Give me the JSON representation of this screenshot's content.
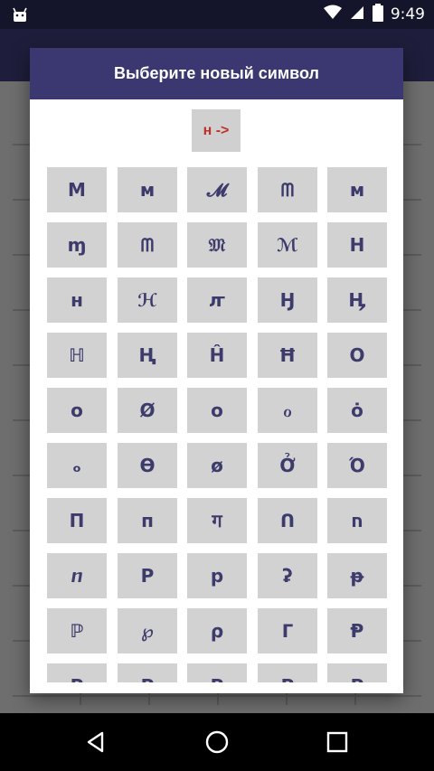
{
  "status_bar": {
    "time": "9:49",
    "icons": [
      "android-icon",
      "wifi-icon",
      "signal-icon",
      "battery-icon"
    ]
  },
  "dialog": {
    "title": "Выберите новый символ",
    "current_symbol": "н ->",
    "symbols": [
      "М",
      "м",
      "𝓜",
      "ᗰ",
      "ᴍ",
      "ɱ",
      "ᗰ",
      "𝔐",
      "ℳ",
      "Н",
      "н",
      "ℋ",
      "ꙥ",
      "Ӈ",
      "Ӊ",
      "ℍ",
      "Ⱨ",
      "Ĥ",
      "Ħ",
      "О",
      "о",
      "Ø",
      "ᴏ",
      "ℴ",
      "ȯ",
      "ₒ",
      "Ѳ",
      "ø",
      "Ở",
      "Ό",
      "П",
      "п",
      "ग",
      "ᑎ",
      "ח",
      "ⴖ",
      "Р",
      "р",
      "ʡ",
      "ᵽ",
      "ℙ",
      "℘",
      "ρ",
      "ᒥ",
      "Ᵽ",
      "Р",
      "Р",
      "Р",
      "Р",
      "Р"
    ]
  },
  "colors": {
    "status_bar_bg": "#14142a",
    "dialog_header_bg": "#3b3770",
    "symbol_text": "#3d3b6b",
    "current_symbol_text": "#c0302a",
    "tile_bg": "#d2d2d2"
  },
  "nav_bar": {
    "icons": [
      "back-icon",
      "home-icon",
      "recents-icon"
    ]
  }
}
